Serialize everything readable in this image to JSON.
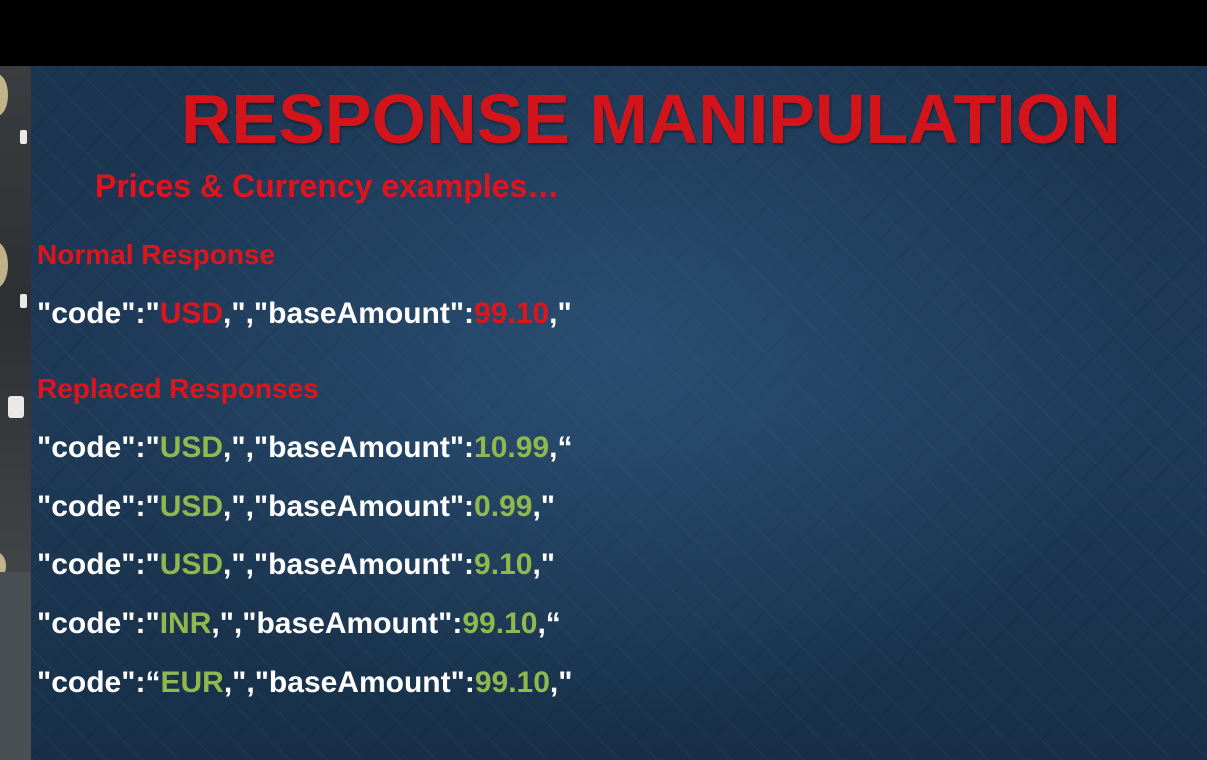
{
  "slide": {
    "title": "RESPONSE MANIPULATION",
    "subtitle": "Prices & Currency examples…",
    "normal": {
      "heading": "Normal Response",
      "line": {
        "prefix": "\"code\":\"",
        "code": "USD",
        "middle": ",\",\"baseAmount\":",
        "amount": "99.10",
        "suffix": ",\""
      }
    },
    "replaced": {
      "heading": "Replaced Responses",
      "lines": [
        {
          "prefix": "\"code\":\"",
          "code": "USD",
          "middle": ",\",\"baseAmount\":",
          "amount": "10.99",
          "suffix": ",“"
        },
        {
          "prefix": "\"code\":\"",
          "code": "USD",
          "middle": ",\",\"baseAmount\":",
          "amount": "0.99",
          "suffix": ",\""
        },
        {
          "prefix": "\"code\":\"",
          "code": "USD",
          "middle": ",\",\"baseAmount\":",
          "amount": "9.10",
          "suffix": ",\""
        },
        {
          "prefix": "\"code\":\"",
          "code": "INR",
          "middle": ",\",\"baseAmount\":",
          "amount": "99.10",
          "suffix": ",“"
        },
        {
          "prefix": "\"code\":“",
          "code": "EUR",
          "middle": ",\",\"baseAmount\":",
          "amount": "99.10",
          "suffix": ",\""
        }
      ]
    }
  },
  "colors": {
    "title_red": "#d4141b",
    "highlight_red": "#e0151c",
    "highlight_green": "#8fb84e",
    "background_blue": "#1d3550"
  }
}
